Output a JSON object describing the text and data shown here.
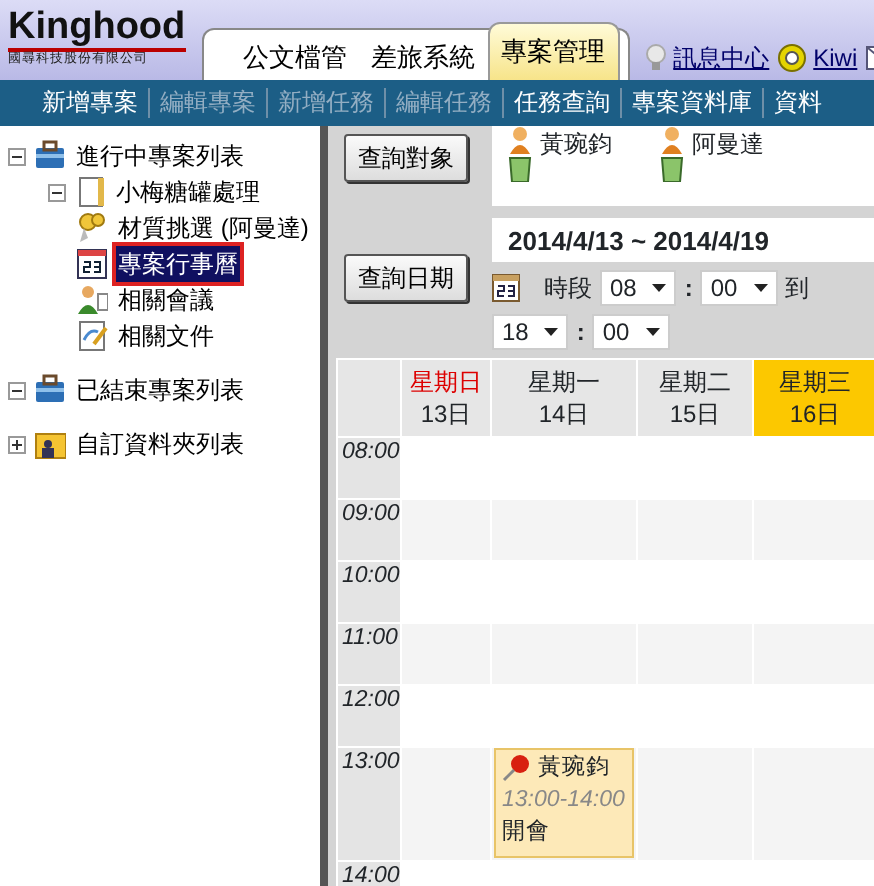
{
  "logo": {
    "name": "Kinghood",
    "subtitle": "國尋科技股份有限公司"
  },
  "app_tabs": [
    {
      "label": "公文檔管",
      "selected": false
    },
    {
      "label": "差旅系統",
      "selected": false
    },
    {
      "label": "專案管理",
      "selected": true
    }
  ],
  "header_links": [
    {
      "label": "訊息中心",
      "kind": "bulb"
    },
    {
      "label": "Kiwi",
      "kind": "user"
    }
  ],
  "menu": [
    {
      "label": "新增專案",
      "disabled": false
    },
    {
      "label": "編輯專案",
      "disabled": true
    },
    {
      "label": "新增任務",
      "disabled": true
    },
    {
      "label": "編輯任務",
      "disabled": true
    },
    {
      "label": "任務查詢",
      "disabled": false
    },
    {
      "label": "專案資料庫",
      "disabled": false
    },
    {
      "label": "資料",
      "disabled": false
    }
  ],
  "tree": [
    {
      "label": "進行中專案列表",
      "kind": "briefcase",
      "expanded": true,
      "selected": false,
      "children": [
        {
          "label": "小梅糖罐處理",
          "kind": "project",
          "expanded": true,
          "selected": false,
          "children": [
            {
              "label": "材質挑選 (阿曼達)",
              "kind": "task",
              "selected": false
            },
            {
              "label": "專案行事曆",
              "kind": "calendar",
              "selected": true
            },
            {
              "label": "相關會議",
              "kind": "meeting",
              "selected": false
            },
            {
              "label": "相關文件",
              "kind": "document",
              "selected": false
            }
          ]
        }
      ]
    },
    {
      "label": "已結束專案列表",
      "kind": "briefcase",
      "expanded": true,
      "selected": false
    },
    {
      "label": "自訂資料夾列表",
      "kind": "folder",
      "expanded": false,
      "selected": false
    }
  ],
  "query": {
    "object_button": "查詢對象",
    "people": [
      {
        "name": "黃琬鈞"
      },
      {
        "name": "阿曼達"
      }
    ],
    "date_range": "2014/4/13 ~ 2014/4/19",
    "date_button": "查詢日期",
    "period_label": "時段",
    "from": {
      "hour": "08",
      "separator": ":",
      "minute": "00"
    },
    "to_label": "到",
    "to": {
      "hour": "18",
      "separator": ":",
      "minute": "00"
    }
  },
  "calendar": {
    "days": [
      {
        "weekday": "星期日",
        "date": "13日",
        "holiday": true,
        "today": false
      },
      {
        "weekday": "星期一",
        "date": "14日",
        "holiday": false,
        "today": false
      },
      {
        "weekday": "星期二",
        "date": "15日",
        "holiday": false,
        "today": false
      },
      {
        "weekday": "星期三",
        "date": "16日",
        "holiday": false,
        "today": true
      }
    ],
    "hours": [
      {
        "label": "08:00"
      },
      {
        "label": "09:00"
      },
      {
        "label": "10:00"
      },
      {
        "label": "11:00"
      },
      {
        "label": "12:00"
      },
      {
        "label": "13:00",
        "cells": [
          {
            "kind": "empty"
          },
          {
            "kind": "event",
            "person": "黃琬鈞",
            "time": "13:00-14:00",
            "title": "開會"
          },
          {
            "kind": "empty"
          },
          {
            "kind": "empty"
          }
        ]
      },
      {
        "label": "14:00"
      }
    ]
  }
}
